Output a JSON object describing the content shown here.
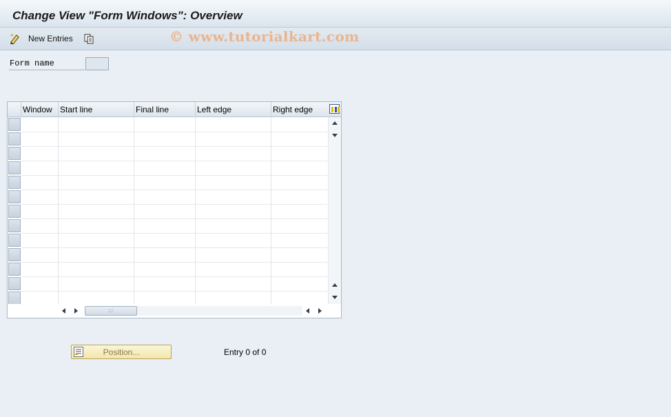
{
  "header": {
    "title": "Change View \"Form Windows\": Overview"
  },
  "toolbar": {
    "new_entries_label": "New Entries"
  },
  "watermark": "© www.tutorialkart.com",
  "form": {
    "field_label": "Form name",
    "field_value": ""
  },
  "table": {
    "columns": [
      "Window",
      "Start line",
      "Final line",
      "Left edge",
      "Right edge"
    ],
    "row_count": 13
  },
  "footer": {
    "position_button_label": "Position...",
    "entry_info": "Entry 0 of 0"
  },
  "icons": {
    "new_entries": "pencil-new-icon",
    "copy": "copy-icon",
    "table_config": "table-settings-icon",
    "position": "position-icon"
  }
}
